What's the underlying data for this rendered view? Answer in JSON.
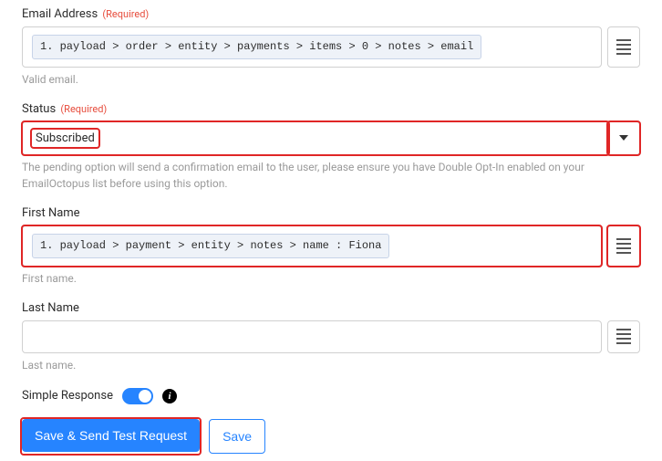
{
  "required_tag": "(Required)",
  "fields": {
    "email": {
      "label": "Email Address",
      "path_pill": "1. payload > order > entity > payments > items > 0 > notes > email",
      "helper": "Valid email."
    },
    "status": {
      "label": "Status",
      "value": "Subscribed",
      "helper": "The pending option will send a confirmation email to the user, please ensure you have Double Opt-In enabled on your EmailOctopus list before using this option."
    },
    "first_name": {
      "label": "First Name",
      "path_pill": "1. payload > payment > entity > notes > name : Fiona",
      "helper": "First name."
    },
    "last_name": {
      "label": "Last Name",
      "helper": "Last name."
    }
  },
  "simple_response": {
    "label": "Simple Response"
  },
  "buttons": {
    "save_send": "Save & Send Test Request",
    "save": "Save"
  }
}
